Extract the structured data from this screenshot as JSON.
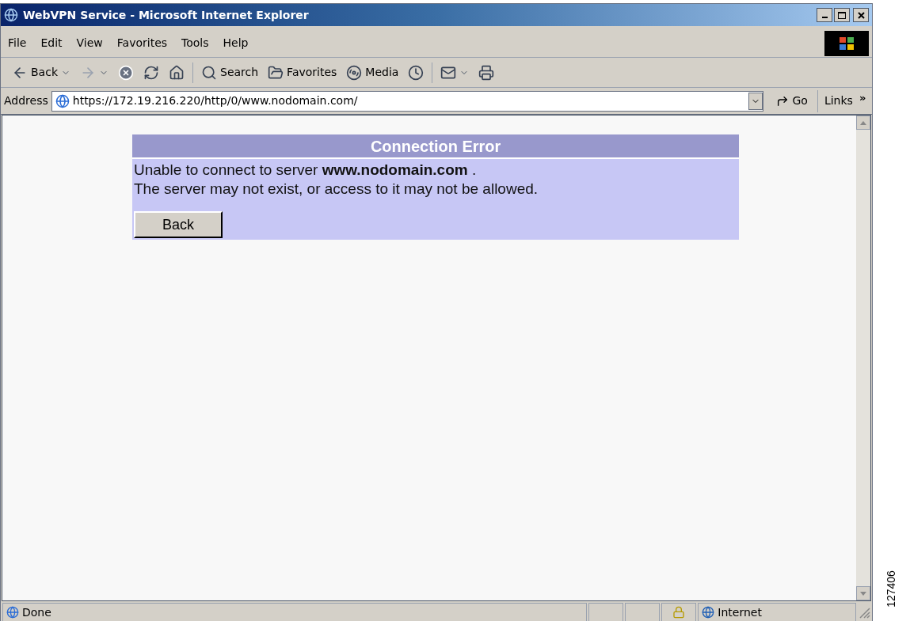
{
  "window": {
    "title": "WebVPN Service - Microsoft Internet Explorer"
  },
  "menu": [
    "File",
    "Edit",
    "View",
    "Favorites",
    "Tools",
    "Help"
  ],
  "toolbar": [
    {
      "kind": "back",
      "label": "Back"
    },
    {
      "kind": "forward"
    },
    {
      "kind": "stop"
    },
    {
      "kind": "refresh"
    },
    {
      "kind": "home"
    },
    {
      "kind": "search",
      "label": "Search"
    },
    {
      "kind": "favorites",
      "label": "Favorites"
    },
    {
      "kind": "media",
      "label": "Media"
    },
    {
      "kind": "history"
    },
    {
      "kind": "mail"
    },
    {
      "kind": "print"
    }
  ],
  "address": {
    "label": "Address",
    "url": "https://172.19.216.220/http/0/www.nodomain.com/",
    "go": "Go",
    "links": "Links",
    "more": "»"
  },
  "error": {
    "title": "Connection Error",
    "lines": [
      "Unable to connect to server **www.nodomain.com** .",
      "The server may not exist, or access to it may not be allowed."
    ],
    "button": "Back"
  },
  "status_bar": {
    "text": "Done",
    "zone": "Internet"
  },
  "figure_number": "127406"
}
